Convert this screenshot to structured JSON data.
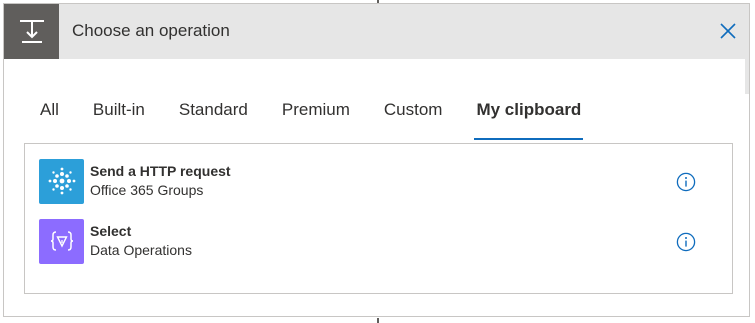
{
  "header": {
    "title": "Choose an operation"
  },
  "tabs": [
    {
      "label": "All",
      "active": false
    },
    {
      "label": "Built-in",
      "active": false
    },
    {
      "label": "Standard",
      "active": false
    },
    {
      "label": "Premium",
      "active": false
    },
    {
      "label": "Custom",
      "active": false
    },
    {
      "label": "My clipboard",
      "active": true
    }
  ],
  "actions": [
    {
      "title": "Send a HTTP request",
      "connector": "Office 365 Groups",
      "icon": "office365-groups-icon",
      "icon_color": "#2c9fd9"
    },
    {
      "title": "Select",
      "connector": "Data Operations",
      "icon": "data-operations-icon",
      "icon_color": "#8c6cff"
    }
  ],
  "colors": {
    "accent": "#0f6cbd",
    "header_bg": "#e6e6e6",
    "header_icon_bg": "#605e5c"
  }
}
